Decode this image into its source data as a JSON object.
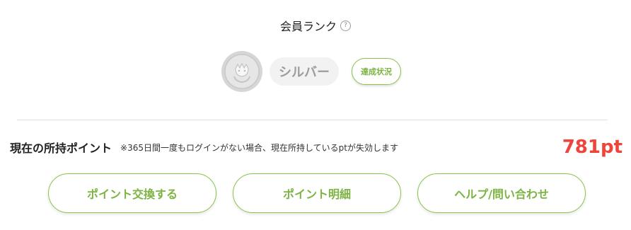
{
  "rank": {
    "title": "会員ランク",
    "help_icon": "question-circle-icon",
    "medal_icon": "silver-medal-icon",
    "name": "シルバー",
    "status_button": "達成状況"
  },
  "points": {
    "label": "現在の所持ポイント",
    "note": "※365日間一度もログインがない場合、現在所持しているptが失効します",
    "value": "781pt"
  },
  "actions": [
    {
      "label": "ポイント交換する"
    },
    {
      "label": "ポイント明細"
    },
    {
      "label": "ヘルプ/問い合わせ"
    }
  ],
  "colors": {
    "accent": "#8bc34a",
    "accent_text": "#7cb342",
    "points_value": "#f0433a",
    "rank_pill_bg": "#f2f2f2",
    "rank_text": "#9c9c9c"
  }
}
